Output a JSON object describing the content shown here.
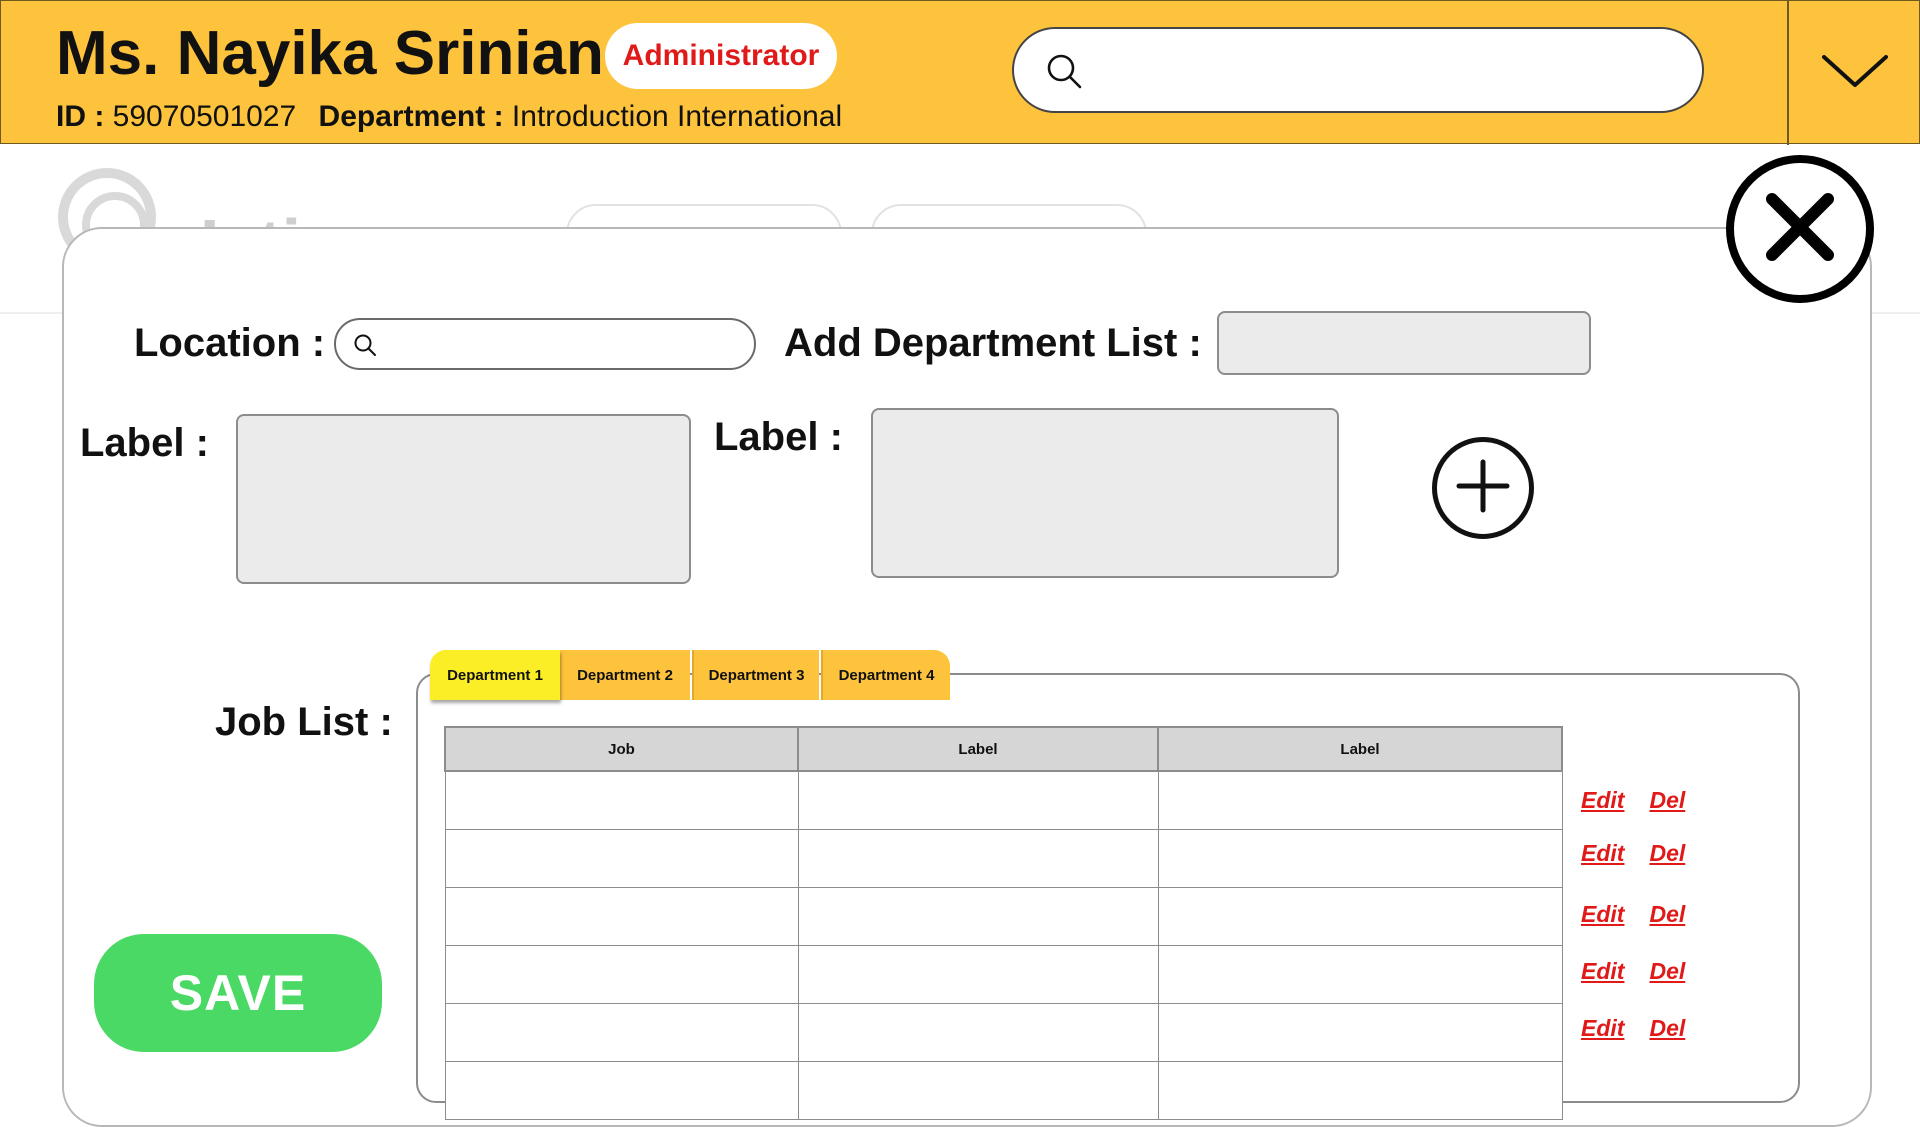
{
  "header": {
    "user_name": "Ms. Nayika Srinian",
    "role": "Administrator",
    "id_label": "ID :",
    "id_value": "59070501027",
    "department_label": "Department :",
    "department_value": "Introduction International",
    "search_value": "",
    "search_icon": "search-icon",
    "menu_icon": "chevron-down-icon"
  },
  "background": {
    "title_fragment": "I..ti.."
  },
  "modal": {
    "close_icon": "close-icon",
    "location_label": "Location :",
    "location_value": "",
    "add_department_label": "Add Department List :",
    "add_department_value": "",
    "label_left": "Label  :",
    "label_left_value": "",
    "label_right": "Label  :",
    "label_right_value": "",
    "add_icon": "plus-circle-icon",
    "job_list_label": "Job List  :",
    "tabs": [
      {
        "label": "Department 1",
        "active": true
      },
      {
        "label": "Department 2",
        "active": false
      },
      {
        "label": "Department 3",
        "active": false
      },
      {
        "label": "Department 4",
        "active": false
      }
    ],
    "table": {
      "columns": [
        "Job",
        "Label",
        "Label"
      ],
      "rows": [
        [
          "",
          "",
          ""
        ],
        [
          "",
          "",
          ""
        ],
        [
          "",
          "",
          ""
        ],
        [
          "",
          "",
          ""
        ],
        [
          "",
          "",
          ""
        ],
        [
          "",
          "",
          ""
        ]
      ]
    },
    "actions": {
      "edit": "Edit",
      "delete": "Del"
    },
    "save_label": "SAVE"
  },
  "colors": {
    "header_bg": "#fec33c",
    "active_tab": "#fcee26",
    "role_text": "#e01919",
    "save_button": "#4bd966",
    "action_link": "#e01919"
  }
}
